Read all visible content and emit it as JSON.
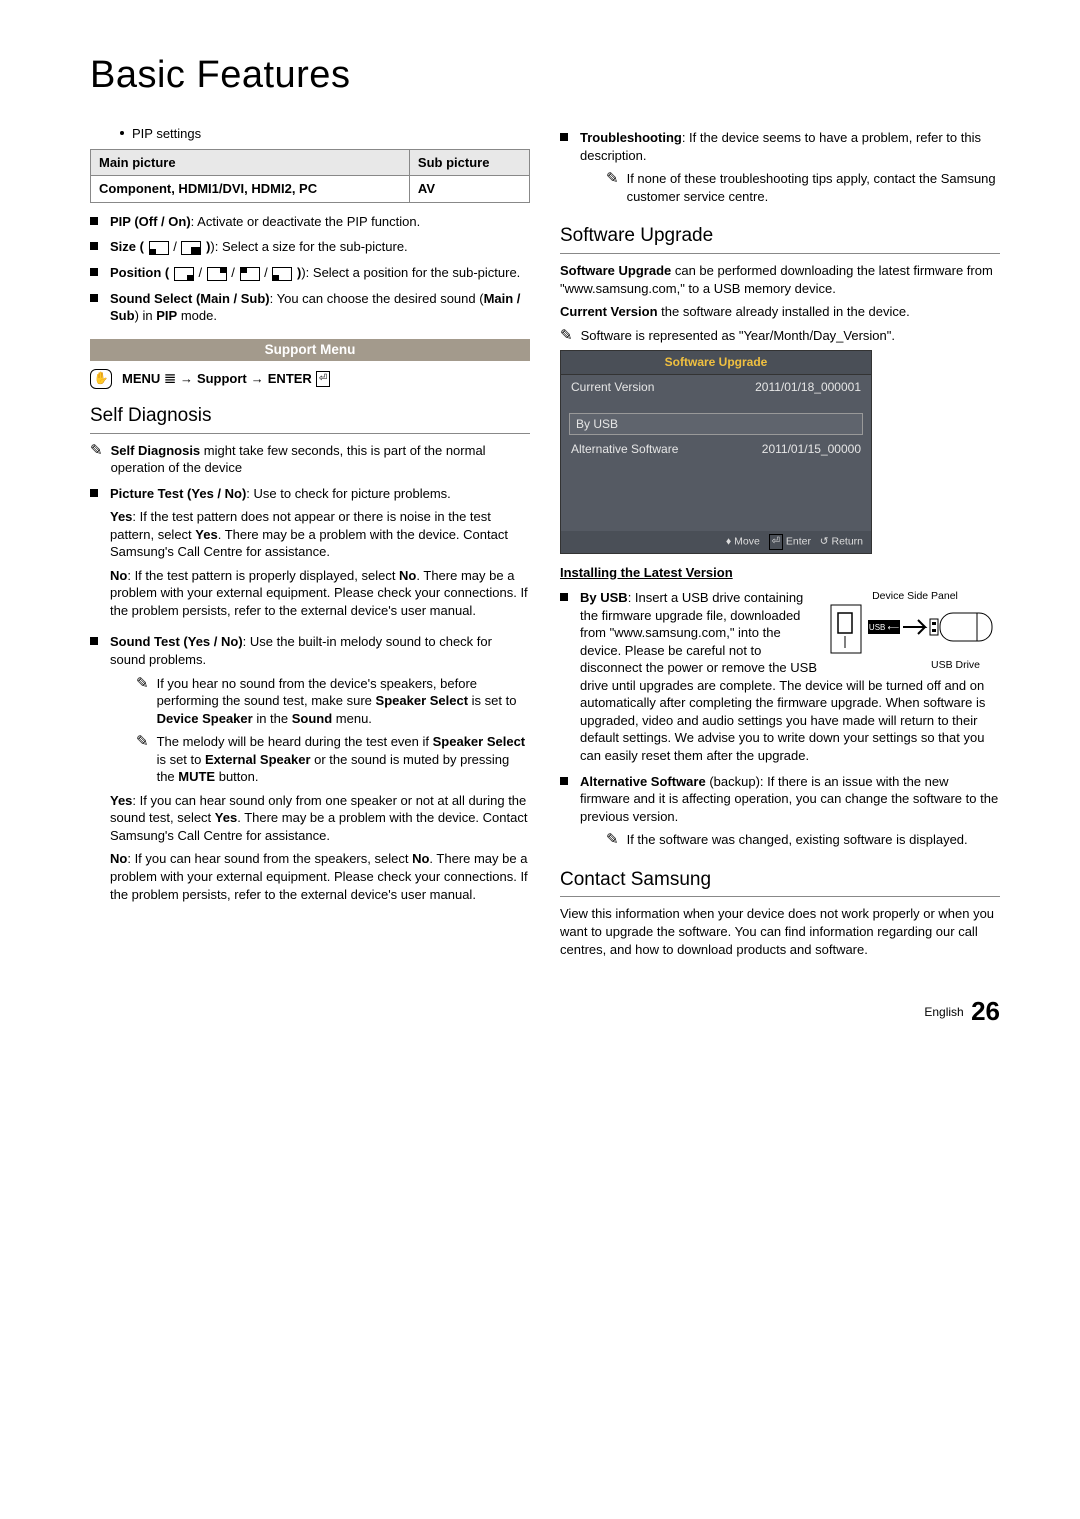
{
  "page_title": "Basic Features",
  "left": {
    "pip_settings_label": "PIP settings",
    "pip_table": {
      "h1": "Main picture",
      "h2": "Sub picture",
      "c1": "Component, HDMI1/DVI, HDMI2, PC",
      "c2": "AV"
    },
    "pip_item": {
      "label": "PIP (Off / On)",
      "text": ": Activate or deactivate the PIP function."
    },
    "size_item": {
      "label": "Size (",
      "text": "): Select a size for the sub-picture."
    },
    "position_item": {
      "label": "Position (",
      "text": "): Select a position for the sub-picture."
    },
    "sound_select_item": {
      "label": "Sound Select (Main / Sub)",
      "text1": ": You can choose the desired sound (",
      "bold": "Main / Sub",
      "text2": ") in ",
      "bold2": "PIP",
      "text3": " mode."
    },
    "support_menu_bar": "Support Menu",
    "menu_line": {
      "menu": "MENU",
      "menu_icon": "𝌆",
      "arrow1": " → ",
      "support": "Support",
      "arrow2": " → ",
      "enter": "ENTER",
      "enter_icon": "⏎"
    },
    "self_diag_heading": "Self Diagnosis",
    "self_diag_note": {
      "bold": "Self Diagnosis",
      "text": " might take few seconds, this is part of the normal operation of the device"
    },
    "picture_test": {
      "label": "Picture Test (Yes / No)",
      "text": ": Use to check for picture problems.",
      "yes_label": "Yes",
      "yes_text1": ": If the test pattern does not appear or there is noise in the test pattern, select ",
      "yes_bold": "Yes",
      "yes_text2": ". There may be a problem with the device. Contact Samsung's Call Centre for assistance.",
      "no_label": "No",
      "no_text1": ": If the test pattern is properly displayed, select ",
      "no_bold": "No",
      "no_text2": ". There may be a problem with your external equipment. Please check your connections. If the problem persists, refer to the external device's user manual."
    },
    "sound_test": {
      "label": "Sound Test (Yes / No)",
      "text": ": Use the built-in melody sound to check for sound problems.",
      "note1a": "If you hear no sound from the device's speakers, before performing the sound test, make sure ",
      "note1b": "Speaker Select",
      "note1c": " is set to ",
      "note1d": "Device Speaker",
      "note1e": " in the ",
      "note1f": "Sound",
      "note1g": " menu.",
      "note2a": "The melody will be heard during the test even if ",
      "note2b": "Speaker Select",
      "note2c": " is set to ",
      "note2d": "External Speaker",
      "note2e": " or the sound is muted by pressing the ",
      "note2f": "MUTE",
      "note2g": " button.",
      "yes_label": "Yes",
      "yes_text1": ": If you can hear sound only from one speaker or not at all during the sound test, select ",
      "yes_bold": "Yes",
      "yes_text2": ". There may be a problem with the device. Contact Samsung's Call Centre for assistance.",
      "no_label": "No",
      "no_text1": ": If you can hear sound from the speakers, select ",
      "no_bold": "No",
      "no_text2": ". There may be a problem with your external equipment. Please check your connections. If the problem persists, refer to the external device's user manual."
    }
  },
  "right": {
    "troubleshoot": {
      "label": "Troubleshooting",
      "text": ": If the device seems to have a problem, refer to this description.",
      "note": "If none of these troubleshooting tips apply, contact the Samsung customer service centre."
    },
    "sw_heading": "Software Upgrade",
    "sw_intro": {
      "bold": "Software Upgrade",
      "text": " can be performed downloading the latest firmware from \"www.samsung.com,\" to a USB memory device."
    },
    "current_version_label": "Current Version",
    "current_version_text": " the software already installed in the device.",
    "sw_note": "Software is represented as \"Year/Month/Day_Version\".",
    "osd": {
      "title": "Software Upgrade",
      "cv_label": "Current Version",
      "cv_value": "2011/01/18_000001",
      "by_usb": "By USB",
      "alt_label": "Alternative Software",
      "alt_value": "2011/01/15_00000",
      "footer_move": "Move",
      "footer_enter": "Enter",
      "footer_return": "Return"
    },
    "install_heading": "Installing the Latest Version",
    "usb_label": "By USB",
    "usb_text": ": Insert a USB drive containing the firmware upgrade file, downloaded from \"www.samsung.com,\" into the device. Please be careful not to disconnect the power or remove the USB drive until upgrades are complete. The device will be turned off and on automatically after completing the firmware upgrade. When software is upgraded, video and audio settings you have made will return to their default settings. We advise you to write down your settings so that you can easily reset them after the upgrade.",
    "diagram": {
      "panel_label": "Device Side Panel",
      "usb_port": "USB",
      "drive_label": "USB Drive"
    },
    "alt_sw": {
      "label": "Alternative Software",
      "text": " (backup): If there is an issue with the new firmware and it is affecting operation, you can change the software to the previous version.",
      "note": "If the software was changed, existing software is displayed."
    },
    "contact_heading": "Contact Samsung",
    "contact_text": "View this information when your device does not work properly or when you want to upgrade the software. You can find information regarding our call centres, and how to download products and software."
  },
  "footer": {
    "lang": "English",
    "page": "26"
  }
}
